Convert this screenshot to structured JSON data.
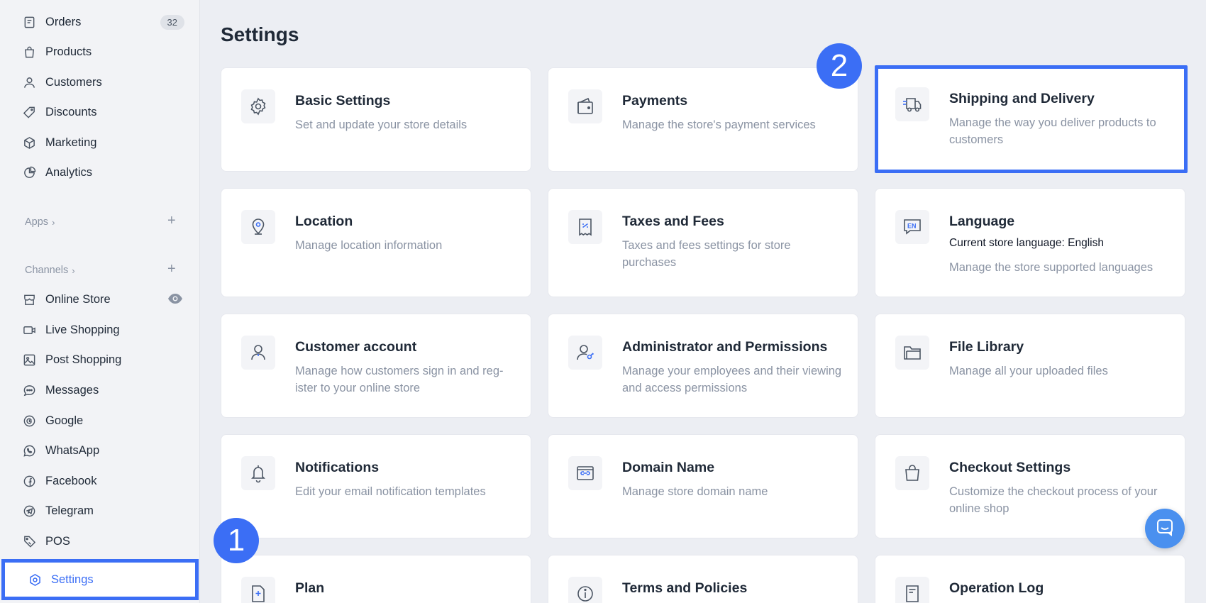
{
  "sidebar": {
    "orders": {
      "label": "Orders",
      "count": "32"
    },
    "products": "Products",
    "customers": "Customers",
    "discounts": "Discounts",
    "marketing": "Marketing",
    "analytics": "Analytics",
    "apps_header": "Apps",
    "channels_header": "Channels",
    "online_store": "Online Store",
    "live_shopping": "Live Shopping",
    "post_shopping": "Post Shopping",
    "messages": "Messages",
    "google": "Google",
    "whatsapp": "WhatsApp",
    "facebook": "Facebook",
    "telegram": "Telegram",
    "pos": "POS",
    "settings": "Settings"
  },
  "main": {
    "title": "Settings",
    "cards": {
      "basic": {
        "title": "Basic Settings",
        "desc": "Set and update your store details"
      },
      "payments": {
        "title": "Payments",
        "desc": "Manage the store's payment services"
      },
      "shipping": {
        "title": "Shipping and Delivery",
        "desc": "Manage the way you deliver products to customers"
      },
      "location": {
        "title": "Location",
        "desc": "Manage location information"
      },
      "taxes": {
        "title": "Taxes and Fees",
        "desc": "Taxes and fees settings for store purchases"
      },
      "language": {
        "title": "Language",
        "current": "Current store language: English",
        "desc": "Manage the store supported languages"
      },
      "customer_account": {
        "title": "Customer account",
        "desc": "Manage how customers sign in and reg­ister to your online store"
      },
      "admin": {
        "title": "Administrator and Permissions",
        "desc": "Manage your employees and their view­ing and access permissions"
      },
      "file_library": {
        "title": "File Library",
        "desc": "Manage all your uploaded files"
      },
      "notifications": {
        "title": "Notifications",
        "desc": "Edit your email notification templates"
      },
      "domain": {
        "title": "Domain Name",
        "desc": "Manage store domain name"
      },
      "checkout": {
        "title": "Checkout Settings",
        "desc": "Customize the checkout process of your online shop"
      },
      "plan": {
        "title": "Plan"
      },
      "terms": {
        "title": "Terms and Policies"
      },
      "operation_log": {
        "title": "Operation Log"
      }
    }
  },
  "markers": {
    "one": "1",
    "two": "2"
  },
  "colors": {
    "accent": "#3b6ef5",
    "icon": "#4b5563",
    "muted": "#8a93a3",
    "chat": "#4a90ef"
  }
}
